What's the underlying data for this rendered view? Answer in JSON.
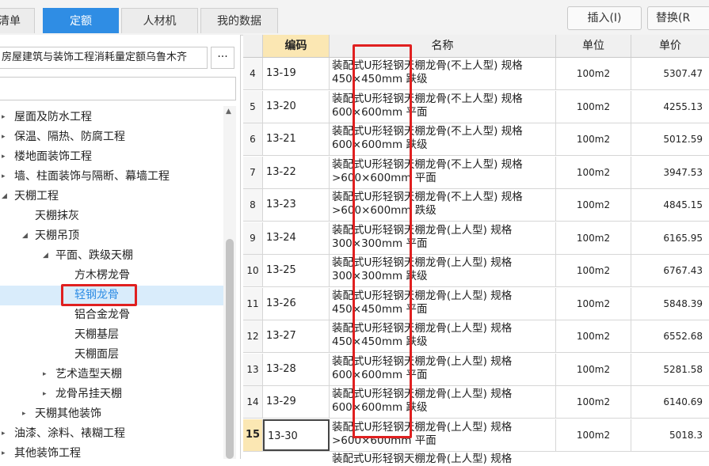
{
  "tabs": {
    "list": "清单",
    "quota": "定额",
    "labor_material": "人材机",
    "my_data": "我的数据"
  },
  "toolbar": {
    "insert": "插入(I)",
    "replace": "替换(R"
  },
  "library": {
    "selected": "房屋建筑与装饰工程消耗量定额乌鲁木齐",
    "more": "···",
    "search_value": ""
  },
  "tree": [
    {
      "label": "屋面及防水工程",
      "depth": 0,
      "expanded": false
    },
    {
      "label": "保温、隔热、防腐工程",
      "depth": 0,
      "expanded": false
    },
    {
      "label": "楼地面装饰工程",
      "depth": 0,
      "expanded": false
    },
    {
      "label": "墙、柱面装饰与隔断、幕墙工程",
      "depth": 0,
      "expanded": false
    },
    {
      "label": "天棚工程",
      "depth": 0,
      "expanded": true
    },
    {
      "label": "天棚抹灰",
      "depth": 1,
      "leaf": true
    },
    {
      "label": "天棚吊顶",
      "depth": 1,
      "expanded": true
    },
    {
      "label": "平面、跌级天棚",
      "depth": 2,
      "expanded": true
    },
    {
      "label": "方木楞龙骨",
      "depth": 3,
      "leaf": true
    },
    {
      "label": "轻钢龙骨",
      "depth": 3,
      "leaf": true,
      "selected": true
    },
    {
      "label": "铝合金龙骨",
      "depth": 3,
      "leaf": true
    },
    {
      "label": "天棚基层",
      "depth": 3,
      "leaf": true
    },
    {
      "label": "天棚面层",
      "depth": 3,
      "leaf": true
    },
    {
      "label": "艺术造型天棚",
      "depth": 2,
      "expanded": false
    },
    {
      "label": "龙骨吊挂天棚",
      "depth": 2,
      "expanded": false
    },
    {
      "label": "天棚其他装饰",
      "depth": 1,
      "expanded": false
    },
    {
      "label": "油漆、涂料、裱糊工程",
      "depth": 0,
      "expanded": false
    },
    {
      "label": "其他装饰工程",
      "depth": 0,
      "expanded": false
    }
  ],
  "table": {
    "headers": {
      "code": "编码",
      "name": "名称",
      "unit": "单位",
      "price": "单价"
    },
    "rows": [
      {
        "idx": "4",
        "code": "13-19",
        "name1": "装配式U形轻钢天棚龙骨(不上人型) 规格",
        "name2": "450×450mm 跌级",
        "unit": "100m2",
        "price": "5307.47"
      },
      {
        "idx": "5",
        "code": "13-20",
        "name1": "装配式U形轻钢天棚龙骨(不上人型) 规格",
        "name2": "600×600mm 平面",
        "unit": "100m2",
        "price": "4255.13"
      },
      {
        "idx": "6",
        "code": "13-21",
        "name1": "装配式U形轻钢天棚龙骨(不上人型) 规格",
        "name2": "600×600mm 跌级",
        "unit": "100m2",
        "price": "5012.59"
      },
      {
        "idx": "7",
        "code": "13-22",
        "name1": "装配式U形轻钢天棚龙骨(不上人型) 规格",
        "name2": ">600×600mm 平面",
        "unit": "100m2",
        "price": "3947.53"
      },
      {
        "idx": "8",
        "code": "13-23",
        "name1": "装配式U形轻钢天棚龙骨(不上人型) 规格",
        "name2": ">600×600mm 跌级",
        "unit": "100m2",
        "price": "4845.15"
      },
      {
        "idx": "9",
        "code": "13-24",
        "name1": "装配式U形轻钢天棚龙骨(上人型) 规格",
        "name2": "300×300mm 平面",
        "unit": "100m2",
        "price": "6165.95"
      },
      {
        "idx": "10",
        "code": "13-25",
        "name1": "装配式U形轻钢天棚龙骨(上人型) 规格",
        "name2": "300×300mm 跌级",
        "unit": "100m2",
        "price": "6767.43"
      },
      {
        "idx": "11",
        "code": "13-26",
        "name1": "装配式U形轻钢天棚龙骨(上人型) 规格",
        "name2": "450×450mm 平面",
        "unit": "100m2",
        "price": "5848.39"
      },
      {
        "idx": "12",
        "code": "13-27",
        "name1": "装配式U形轻钢天棚龙骨(上人型) 规格",
        "name2": "450×450mm 跌级",
        "unit": "100m2",
        "price": "6552.68"
      },
      {
        "idx": "13",
        "code": "13-28",
        "name1": "装配式U形轻钢天棚龙骨(上人型) 规格",
        "name2": "600×600mm 平面",
        "unit": "100m2",
        "price": "5281.58"
      },
      {
        "idx": "14",
        "code": "13-29",
        "name1": "装配式U形轻钢天棚龙骨(上人型) 规格",
        "name2": "600×600mm 跌级",
        "unit": "100m2",
        "price": "6140.69"
      },
      {
        "idx": "15",
        "code": "13-30",
        "name1": "装配式U形轻钢天棚龙骨(上人型) 规格",
        "name2": ">600×600mm 平面",
        "unit": "100m2",
        "price": "5018.3"
      }
    ],
    "partial_row_name": "装配式U形轻钢天棚龙骨(上人型) 规格"
  },
  "colors": {
    "accent": "#2f8de4",
    "highlight": "#e02020",
    "header_code": "#fbe7b3"
  }
}
